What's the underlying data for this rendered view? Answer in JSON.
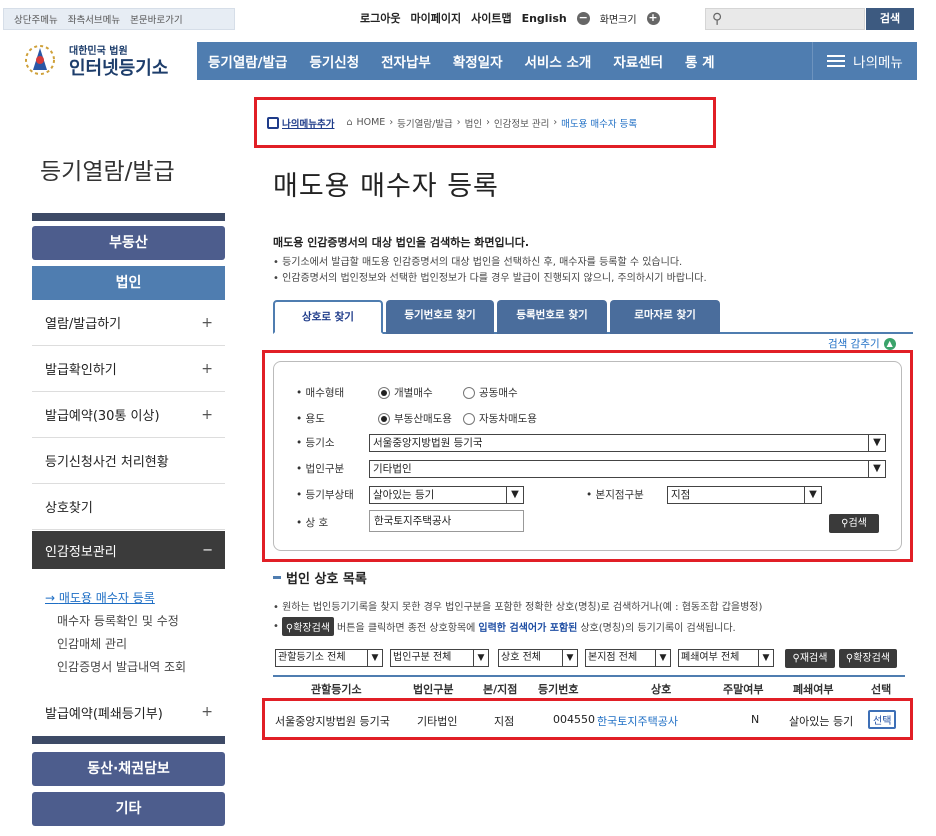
{
  "topbar": {
    "skip_links": [
      "상단주메뉴",
      "좌측서브메뉴",
      "본문바로가기"
    ],
    "links": [
      "로그아웃",
      "마이페이지",
      "사이트맵",
      "English"
    ],
    "zoom_label": "화면크기",
    "search_button": "검색"
  },
  "logo": {
    "small": "대한민국 법원",
    "large": "인터넷등기소"
  },
  "gnb": {
    "items": [
      "등기열람/발급",
      "등기신청",
      "전자납부",
      "확정일자",
      "서비스 소개",
      "자료센터",
      "통 계"
    ],
    "my_menu": "나의메뉴"
  },
  "breadcrumb": {
    "add_menu": "나의메뉴추가",
    "path": [
      "HOME",
      "등기열람/발급",
      "법인",
      "인감정보 관리",
      "매도용 매수자 등록"
    ]
  },
  "sidebar": {
    "title": "등기열람/발급",
    "btn_realestate": "부동산",
    "tab_corp": "법인",
    "items": [
      "열람/발급하기",
      "발급확인하기",
      "발급예약(30통 이상)",
      "등기신청사건 처리현황",
      "상호찾기"
    ],
    "active": "인감정보관리",
    "subitems": [
      "매도용 매수자 등록",
      "매수자 등록확인 및 수정",
      "인감매체 관리",
      "인감증명서 발급내역 조회"
    ],
    "item_after": "발급예약(폐쇄등기부)",
    "btn_movable": "동산·채권담보",
    "btn_other": "기타"
  },
  "main": {
    "title": "매도용 매수자 등록",
    "desc_title": "매도용 인감증명서의 대상 법인을 검색하는 화면입니다.",
    "desc_lines": [
      "• 등기소에서 발급할 매도용 인감증명서의 대상 법인을 선택하신 후, 매수자를 등록할 수 있습니다.",
      "• 인감증명서의 법인정보와 선택한 법인정보가 다를 경우 발급이 진행되지 않으니, 주의하시기 바랍니다."
    ],
    "tabs": [
      "상호로 찾기",
      "등기번호로 찾기",
      "등록번호로 찾기",
      "로마자로 찾기"
    ],
    "collapse": "검색 감추기"
  },
  "form": {
    "buyer_type_label": "• 매수형태",
    "buyer_type_options": [
      "개별매수",
      "공동매수"
    ],
    "usage_label": "• 용도",
    "usage_options": [
      "부동산매도용",
      "자동차매도용"
    ],
    "registry_label": "• 등기소",
    "registry_value": "서울중앙지방법원 등기국",
    "corp_type_label": "• 법인구분",
    "corp_type_value": "기타법인",
    "status_label": "• 등기부상태",
    "status_value": "살아있는 등기",
    "branch_label": "• 본지점구분",
    "branch_value": "지점",
    "name_label": "• 상 호",
    "name_value": "한국토지주택공사",
    "search_btn": "검색"
  },
  "list": {
    "title": "법인 상호 목록",
    "note1": "• 원하는 법인등기기록을 찾지 못한 경우 법인구분을 포함한 정확한 상호(명칭)로 검색하거나(예 : 협동조합 갑을병정)",
    "note2_btn": "확장검색",
    "note2_a": "버튼을 클릭하면 종전 상호항목에 ",
    "note2_hl": "입력한 검색어가 포함된",
    "note2_b": " 상호(명칭)의 등기기록이 검색됩니다.",
    "filters": [
      "관할등기소 전체",
      "법인구분 전체",
      "상호 전체",
      "본지점 전체",
      "폐쇄여부 전체"
    ],
    "re_search": "재검색",
    "ext_search": "확장검색",
    "headers": [
      "관할등기소",
      "법인구분",
      "본/지점",
      "등기번호",
      "상호",
      "주말여부",
      "폐쇄여부",
      "선택"
    ],
    "rows": [
      [
        "서울중앙지방법원 등기국",
        "기타법인",
        "지점",
        "004550",
        "한국토지주택공사",
        "N",
        "살아있는 등기",
        "선택"
      ]
    ]
  }
}
